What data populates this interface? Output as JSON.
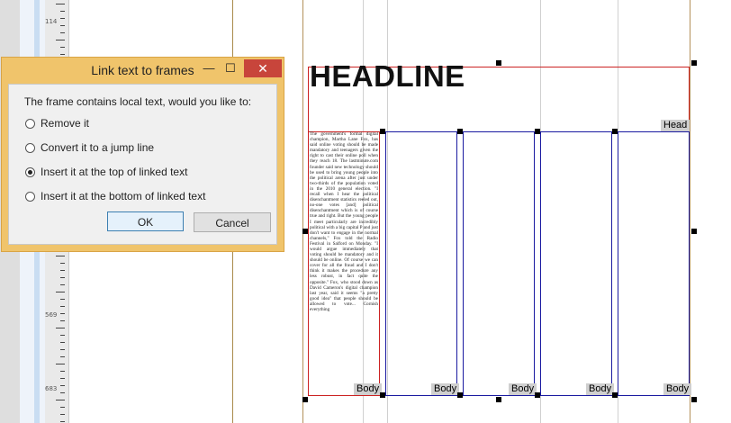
{
  "ruler": {
    "marks": [
      "114",
      "569",
      "683"
    ]
  },
  "page": {
    "headline": "HEADLINE",
    "tags": {
      "head": "Head",
      "body": "Body"
    },
    "body_text": "The government's formal digital champion, Martha Lane Fox, has said online voting should be made mandatory and teenagers given the right to cast their online poll when they reach 18. The lastminute.com founder said new technology should be used to bring young people into the political arena after just under two-thirds of the population voted in the 2010 general election. \"I recall when I hear the political disenchantment statistics reeled out, no-one votes [and] political disenchantment which is of course true and right. But the young people I meet particularly are incredibly political with a big capital P and just don't want to engage in the normal channels,\" Fox told the Radio Festival in Salford on Monday. \"I would argue immediately that voting should be mandatory and it should be online. Of course we can cover for all the fraud and I don't think it makes the procedure any less robust, in fact quite the opposite.\" Fox, who stood down as David Cameron's digital champion last year, said it seems \"a pretty good idea\" that people should be allowed to vote... Cornish everything"
  },
  "dialog": {
    "title": "Link text to frames",
    "min_glyph": "—",
    "max_glyph": "☐",
    "close_glyph": "✕",
    "prompt": "The frame contains local text, would you like to:",
    "options": [
      {
        "label": "Remove it",
        "selected": false
      },
      {
        "label": "Convert it to a jump line",
        "selected": false
      },
      {
        "label": "Insert it at the top of linked text",
        "selected": true
      },
      {
        "label": "Insert it at the bottom of linked text",
        "selected": false
      }
    ],
    "ok_label": "OK",
    "cancel_label": "Cancel"
  },
  "colors": {
    "dialog_frame": "#f0c46b",
    "close_button": "#c8453b",
    "headline_frame": "#cc2222",
    "column_frame": "#1a1aa0"
  }
}
